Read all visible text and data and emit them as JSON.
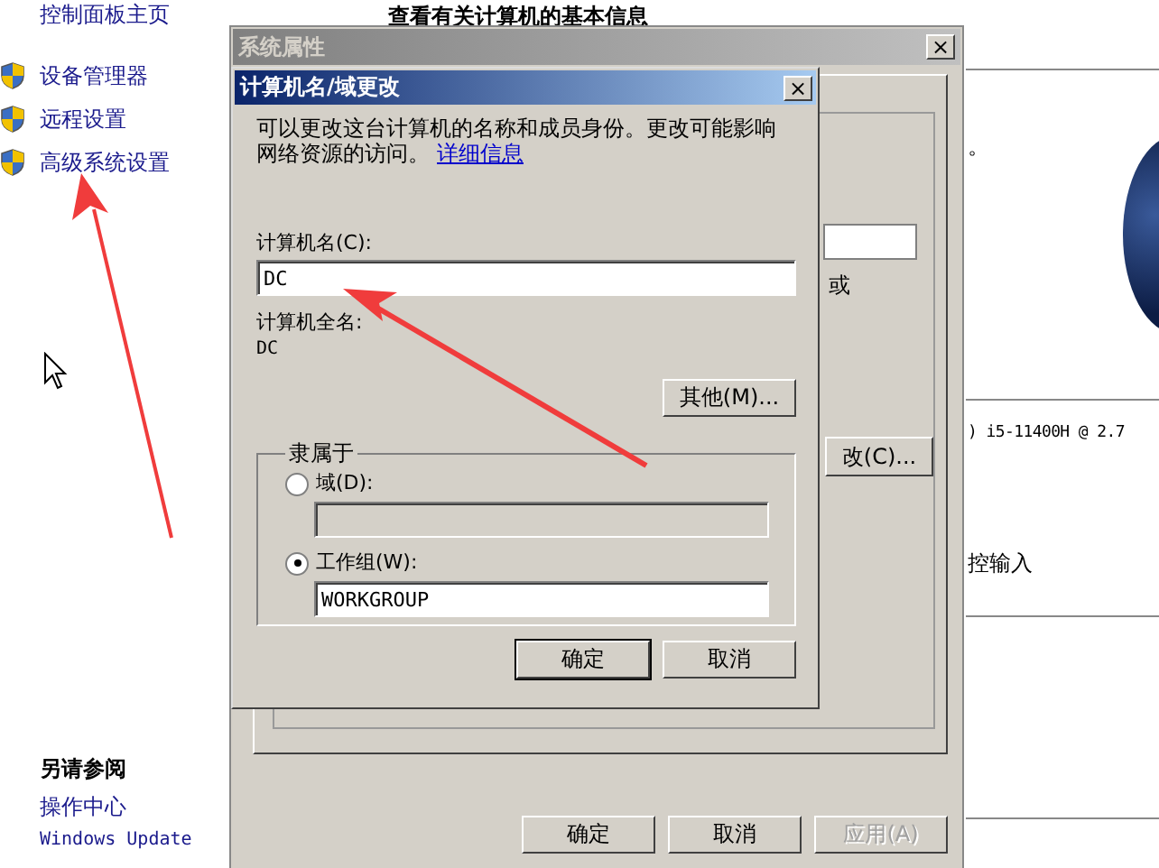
{
  "sidebar": {
    "home": "控制面板主页",
    "items": [
      {
        "label": "设备管理器"
      },
      {
        "label": "远程设置"
      },
      {
        "label": "高级系统设置"
      }
    ],
    "see_also": {
      "title": "另请参阅",
      "links": [
        "操作中心",
        "Windows Update"
      ]
    }
  },
  "page": {
    "heading": "查看有关计算机的基本信息",
    "fragment_1": "。",
    "fragment_2": ") i5-11400H @ 2.7",
    "fragment_3": "控输入"
  },
  "system_properties": {
    "title": "系统属性",
    "close": "×",
    "fragment": "或",
    "change_button": "改(C)...",
    "buttons": [
      {
        "label": "确定",
        "disabled": false
      },
      {
        "label": "取消",
        "disabled": false
      },
      {
        "label": "应用(A)",
        "disabled": true
      }
    ]
  },
  "dialog": {
    "title": "计算机名/域更改",
    "close": "×",
    "description": "可以更改这台计算机的名称和成员身份。更改可能影响网络资源的访问。",
    "link": "详细信息",
    "name_label": "计算机名(C):",
    "name_value": "DC",
    "full_name_label": "计算机全名:",
    "full_name_value": "DC",
    "more_button": "其他(M)...",
    "membership": {
      "title": "隶属于",
      "options": [
        {
          "label": "域(D):",
          "selected": false
        },
        {
          "label": "工作组(W):",
          "selected": true,
          "value": "WORKGROUP"
        }
      ]
    },
    "buttons": [
      {
        "label": "确定",
        "default": true
      },
      {
        "label": "取消",
        "default": false
      }
    ]
  }
}
